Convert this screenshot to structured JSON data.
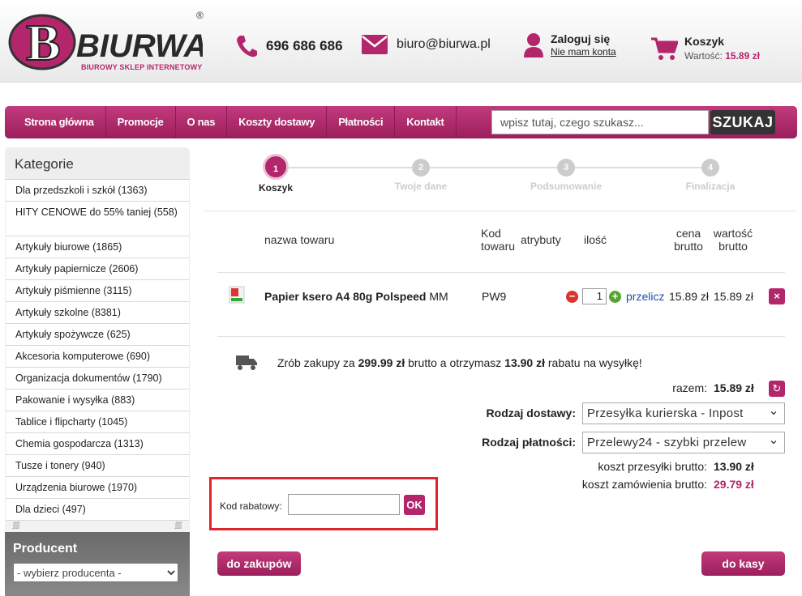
{
  "header": {
    "logo_text": "BIURWA",
    "logo_reg": "®",
    "logo_tagline": "BIUROWY SKLEP INTERNETOWY",
    "phone": "696 686 686",
    "email": "biuro@biurwa.pl",
    "login_label": "Zaloguj się",
    "no_account": "Nie mam konta",
    "cart_label": "Koszyk",
    "cart_value_label": "Wartość:",
    "cart_value": "15.89 zł"
  },
  "nav": {
    "items": [
      "Strona główna",
      "Promocje",
      "O nas",
      "Koszty dostawy",
      "Płatności",
      "Kontakt"
    ],
    "search_placeholder": "wpisz tutaj, czego szukasz...",
    "search_button": "SZUKAJ"
  },
  "sidebar": {
    "title": "Kategorie",
    "categories": [
      "Dla przedszkoli i szkół (1363)",
      "HITY CENOWE do 55% taniej (558)",
      "Artykuły biurowe (1865)",
      "Artykuły papiernicze (2606)",
      "Artykuły piśmienne (3115)",
      "Artykuły szkolne (8381)",
      "Artykuły spożywcze (625)",
      "Akcesoria komputerowe (690)",
      "Organizacja dokumentów (1790)",
      "Pakowanie i wysyłka (883)",
      "Tablice i flipcharty (1045)",
      "Chemia gospodarcza (1313)",
      "Tusze i tonery (940)",
      "Urządzenia biurowe (1970)",
      "Dla dzieci (497)"
    ],
    "producer_title": "Producent",
    "producer_select": "- wybierz producenta -"
  },
  "steps": [
    {
      "num": "1",
      "label": "Koszyk"
    },
    {
      "num": "2",
      "label": "Twoje dane"
    },
    {
      "num": "3",
      "label": "Podsumowanie"
    },
    {
      "num": "4",
      "label": "Finalizacja"
    }
  ],
  "table": {
    "headers": {
      "name": "nazwa towaru",
      "code": "Kod towaru",
      "attrs": "atrybuty",
      "qty": "ilość",
      "price": "cena brutto",
      "value": "wartość brutto"
    },
    "row": {
      "name": "Papier ksero A4 80g Polspeed",
      "name_suffix": "MM",
      "code": "PW9",
      "qty": "1",
      "recalc": "przelicz",
      "price": "15.89 zł",
      "value": "15.89 zł"
    }
  },
  "promo": {
    "pre": "Zrób zakupy za",
    "amount": "299.99 zł",
    "mid": "brutto a otrzymasz",
    "discount": "13.90 zł",
    "post": "rabatu na wysyłkę!"
  },
  "summary": {
    "total_label": "razem:",
    "total": "15.89 zł",
    "delivery_label": "Rodzaj dostawy:",
    "delivery_value": "Przesyłka kurierska - Inpost",
    "payment_label": "Rodzaj płatności:",
    "payment_value": "Przelewy24 - szybki przelew",
    "shipping_label": "koszt przesyłki brutto:",
    "shipping": "13.90 zł",
    "order_label": "koszt zamówienia brutto:",
    "order": "29.79 zł"
  },
  "coupon": {
    "label": "Kod rabatowy:",
    "button": "OK"
  },
  "buttons": {
    "back": "do zakupów",
    "checkout": "do kasy"
  },
  "colors": {
    "brand": "#b3266b",
    "alert_border": "#e0242b"
  }
}
